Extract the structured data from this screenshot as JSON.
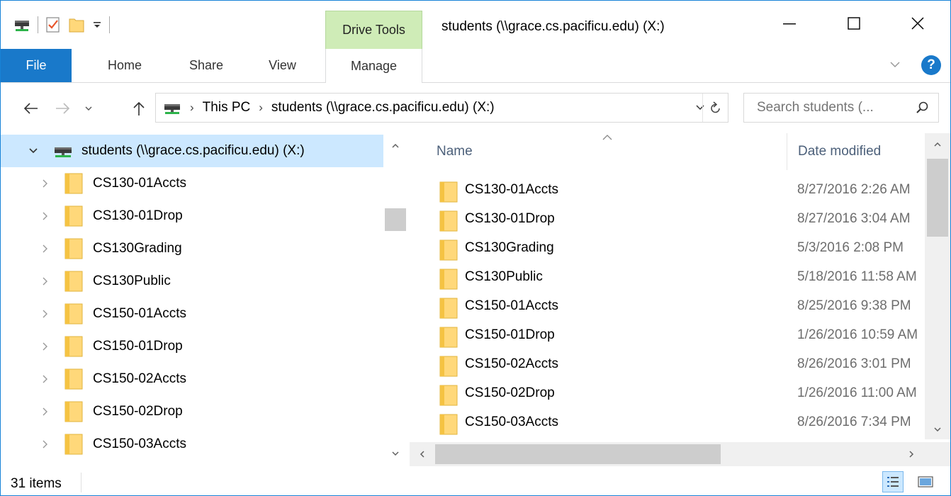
{
  "window": {
    "title": "students (\\\\grace.cs.pacificu.edu) (X:)",
    "context_tab_group": "Drive Tools"
  },
  "ribbon": {
    "tabs": [
      {
        "label": "File"
      },
      {
        "label": "Home"
      },
      {
        "label": "Share"
      },
      {
        "label": "View"
      },
      {
        "label": "Manage"
      }
    ],
    "help_label": "?"
  },
  "address_bar": {
    "crumbs": [
      "This PC",
      "students (\\\\grace.cs.pacificu.edu) (X:)"
    ]
  },
  "search": {
    "placeholder": "Search students (..."
  },
  "nav_pane": {
    "root": "students (\\\\grace.cs.pacificu.edu) (X:)",
    "items": [
      {
        "label": "CS130-01Accts"
      },
      {
        "label": "CS130-01Drop"
      },
      {
        "label": "CS130Grading"
      },
      {
        "label": "CS130Public"
      },
      {
        "label": "CS150-01Accts"
      },
      {
        "label": "CS150-01Drop"
      },
      {
        "label": "CS150-02Accts"
      },
      {
        "label": "CS150-02Drop"
      },
      {
        "label": "CS150-03Accts"
      }
    ]
  },
  "content": {
    "columns": {
      "name": "Name",
      "date": "Date modified"
    },
    "rows": [
      {
        "name": "CS130-01Accts",
        "date": "8/27/2016 2:26 AM"
      },
      {
        "name": "CS130-01Drop",
        "date": "8/27/2016 3:04 AM"
      },
      {
        "name": "CS130Grading",
        "date": "5/3/2016 2:08 PM"
      },
      {
        "name": "CS130Public",
        "date": "5/18/2016 11:58 AM"
      },
      {
        "name": "CS150-01Accts",
        "date": "8/25/2016 9:38 PM"
      },
      {
        "name": "CS150-01Drop",
        "date": "1/26/2016 10:59 AM"
      },
      {
        "name": "CS150-02Accts",
        "date": "8/26/2016 3:01 PM"
      },
      {
        "name": "CS150-02Drop",
        "date": "1/26/2016 11:00 AM"
      },
      {
        "name": "CS150-03Accts",
        "date": "8/26/2016 7:34 PM"
      }
    ]
  },
  "status": {
    "item_count": "31 items"
  },
  "colors": {
    "accent": "#1979ca",
    "selection": "#cce8ff",
    "context_tab": "#cfecb7",
    "folder": "#ffd87a"
  }
}
